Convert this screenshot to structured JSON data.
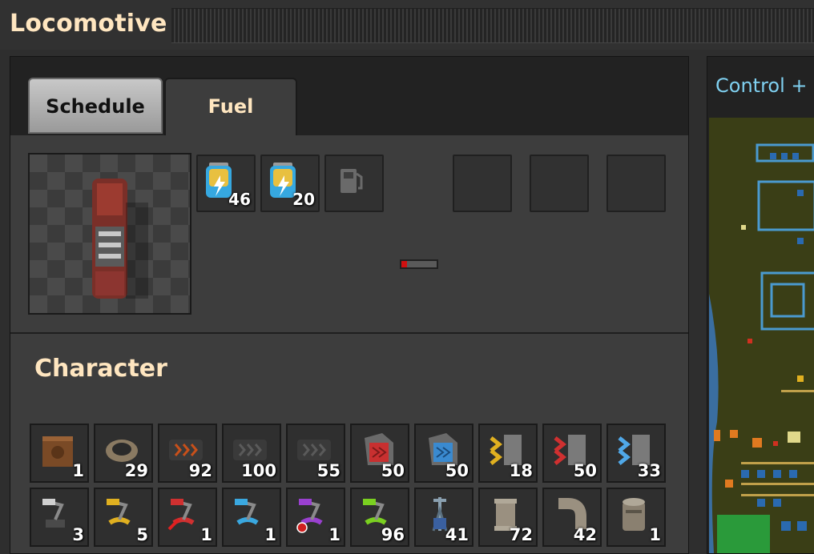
{
  "window": {
    "title": "Locomotive"
  },
  "tabs": [
    {
      "label": "Schedule",
      "active": false
    },
    {
      "label": "Fuel",
      "active": true
    }
  ],
  "fuel": {
    "slots": [
      {
        "icon": "battery-icon",
        "count": "46"
      },
      {
        "icon": "battery-icon",
        "count": "20"
      },
      {
        "icon": "fuel-pump-icon",
        "count": ""
      },
      {
        "icon": "empty",
        "count": ""
      },
      {
        "icon": "empty",
        "count": ""
      },
      {
        "icon": "empty",
        "count": ""
      }
    ],
    "burner_progress": 0.15,
    "burner_color": "#d01010"
  },
  "character": {
    "title": "Character",
    "row1": [
      {
        "icon": "wooden-chest-icon",
        "count": "1"
      },
      {
        "icon": "stone-furnace-icon",
        "count": "29"
      },
      {
        "icon": "transport-belt-icon",
        "count": "92"
      },
      {
        "icon": "fast-transport-belt-icon",
        "count": "100"
      },
      {
        "icon": "express-transport-belt-icon",
        "count": "55"
      },
      {
        "icon": "red-underground-belt-icon",
        "count": "50"
      },
      {
        "icon": "blue-underground-belt-icon",
        "count": "50"
      },
      {
        "icon": "yellow-splitter-icon",
        "count": "18"
      },
      {
        "icon": "red-splitter-icon",
        "count": "50"
      },
      {
        "icon": "blue-splitter-icon",
        "count": "33"
      }
    ],
    "row2": [
      {
        "icon": "burner-inserter-icon",
        "count": "3"
      },
      {
        "icon": "inserter-icon",
        "count": "5"
      },
      {
        "icon": "long-handed-inserter-icon",
        "count": "1"
      },
      {
        "icon": "fast-inserter-icon",
        "count": "1"
      },
      {
        "icon": "filter-inserter-icon",
        "count": "1"
      },
      {
        "icon": "stack-inserter-icon",
        "count": "96"
      },
      {
        "icon": "small-electric-pole-icon",
        "count": "41"
      },
      {
        "icon": "pipe-icon",
        "count": "72"
      },
      {
        "icon": "pipe-elbow-icon",
        "count": "42"
      },
      {
        "icon": "storage-tank-icon",
        "count": "1"
      }
    ]
  },
  "minimap": {
    "title": "Control + L"
  },
  "colors": {
    "accent": "#ffe6c0",
    "minimap_title": "#7fd0f0"
  }
}
